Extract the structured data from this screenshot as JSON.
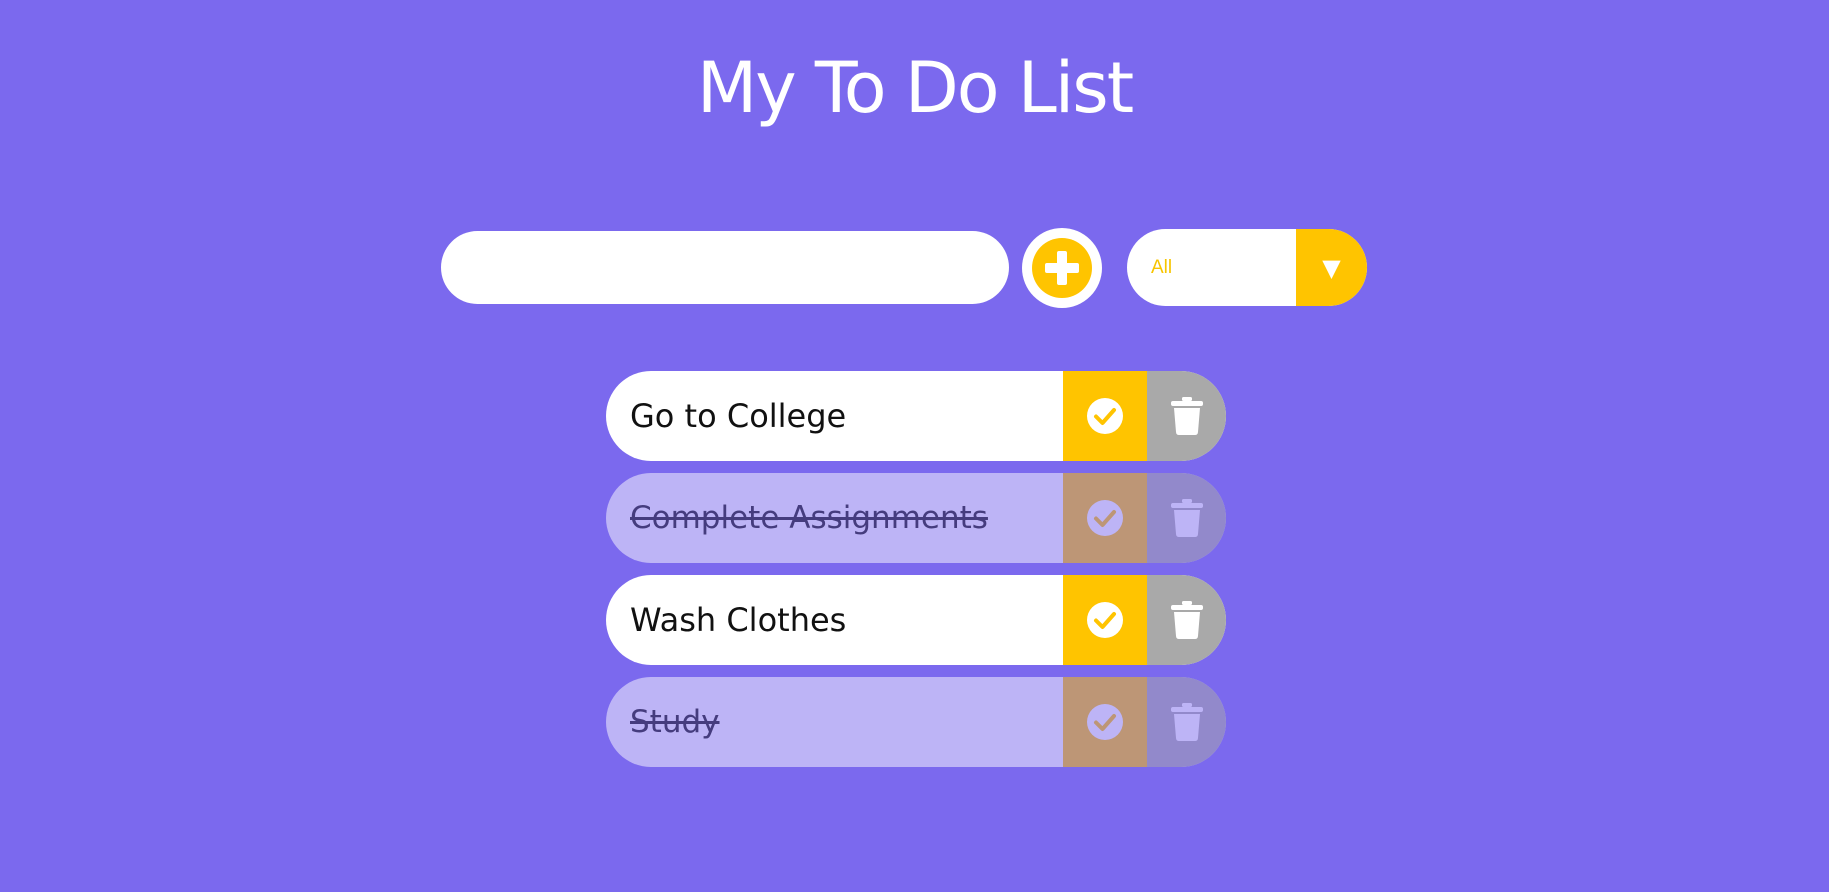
{
  "header": {
    "title": "My To Do List"
  },
  "form": {
    "input_value": "",
    "input_placeholder": "",
    "add_icon": "plus-circle-icon",
    "filter": {
      "selected": "All",
      "arrow": "▼"
    }
  },
  "todos": [
    {
      "text": "Go to College",
      "completed": false
    },
    {
      "text": "Complete Assignments",
      "completed": true
    },
    {
      "text": "Wash Clothes",
      "completed": false
    },
    {
      "text": "Study",
      "completed": true
    }
  ],
  "icons": {
    "check": "check-circle-icon",
    "trash": "trash-icon"
  },
  "colors": {
    "background": "#7b69ee",
    "accent": "#ffc400",
    "trash": "#a9a9a9",
    "surface": "#ffffff"
  }
}
